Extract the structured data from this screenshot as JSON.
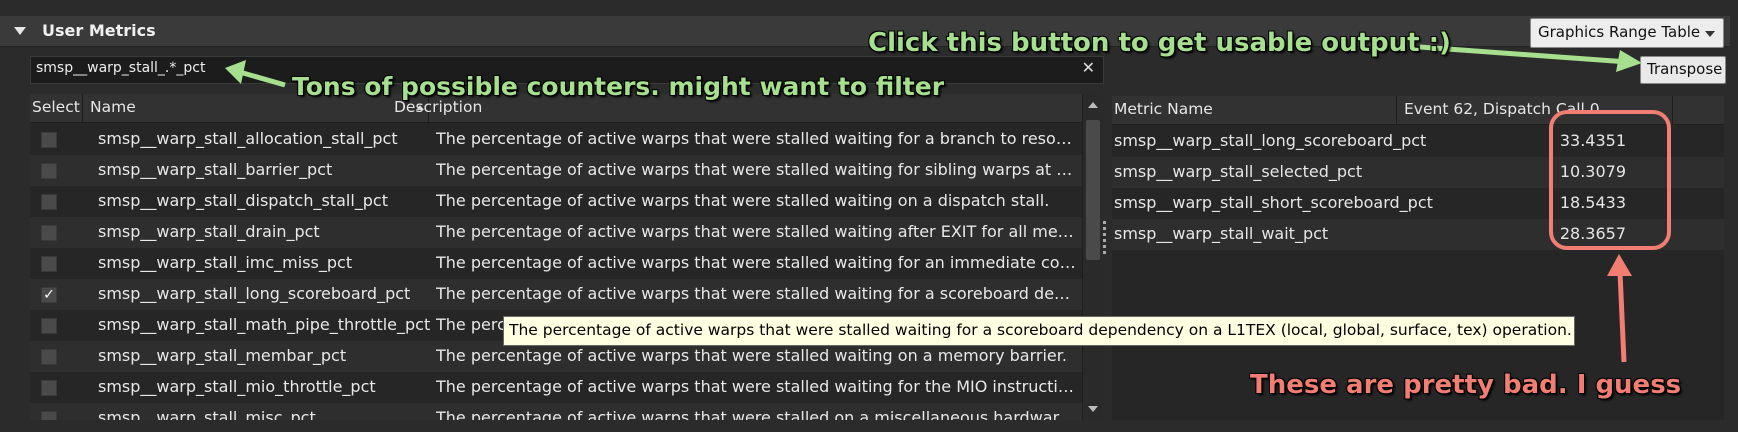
{
  "panel": {
    "title": "User Metrics",
    "view_select": "Graphics Range Table"
  },
  "filter": {
    "value": "smsp__warp_stall_.*_pct",
    "clear_glyph": "✕"
  },
  "left_table": {
    "columns": [
      "Select",
      "Name",
      "Description"
    ],
    "rows": [
      {
        "checked": false,
        "name": "smsp__warp_stall_allocation_stall_pct",
        "desc": "The percentage of active warps that were stalled waiting for a branch to resolve..."
      },
      {
        "checked": false,
        "name": "smsp__warp_stall_barrier_pct",
        "desc": "The percentage of active warps that were stalled waiting for sibling warps at a ..."
      },
      {
        "checked": false,
        "name": "smsp__warp_stall_dispatch_stall_pct",
        "desc": "The percentage of active warps that were stalled waiting on a dispatch stall."
      },
      {
        "checked": false,
        "name": "smsp__warp_stall_drain_pct",
        "desc": "The percentage of active warps that were stalled waiting after EXIT for all mem..."
      },
      {
        "checked": false,
        "name": "smsp__warp_stall_imc_miss_pct",
        "desc": "The percentage of active warps that were stalled waiting for an immediate cons..."
      },
      {
        "checked": true,
        "name": "smsp__warp_stall_long_scoreboard_pct",
        "desc": "The percentage of active warps that were stalled waiting for a scoreboard depe..."
      },
      {
        "checked": false,
        "name": "smsp__warp_stall_math_pipe_throttle_pct",
        "desc": "The percentage of active warps that were stalled waiting for an execution pipe..."
      },
      {
        "checked": false,
        "name": "smsp__warp_stall_membar_pct",
        "desc": "The percentage of active warps that were stalled waiting on a memory barrier."
      },
      {
        "checked": false,
        "name": "smsp__warp_stall_mio_throttle_pct",
        "desc": "The percentage of active warps that were stalled waiting for the MIO instructio..."
      },
      {
        "checked": false,
        "name": "smsp__warp_stall_misc_pct",
        "desc": "The percentage of active warps that were stalled on a miscellaneous hardware r..."
      }
    ]
  },
  "check_glyph": "✓",
  "tooltip": "The percentage of active warps that were stalled waiting for a scoreboard dependency on a L1TEX (local, global, surface, tex) operation.",
  "transpose_label": "Transpose",
  "right_table": {
    "columns": [
      "Metric Name",
      "Event 62, Dispatch Call 0"
    ],
    "rows": [
      {
        "name": "smsp__warp_stall_long_scoreboard_pct",
        "value": "33.4351"
      },
      {
        "name": "smsp__warp_stall_selected_pct",
        "value": "10.3079"
      },
      {
        "name": "smsp__warp_stall_short_scoreboard_pct",
        "value": "18.5433"
      },
      {
        "name": "smsp__warp_stall_wait_pct",
        "value": "28.3657"
      }
    ]
  },
  "annotations": {
    "click_button": "Click this button to get usable output :)",
    "filter_hint": "Tons of possible counters. might want to filter",
    "bad_values": "These are pretty bad. I guess",
    "green": "#a6e08e",
    "salmon": "#f27d72"
  }
}
